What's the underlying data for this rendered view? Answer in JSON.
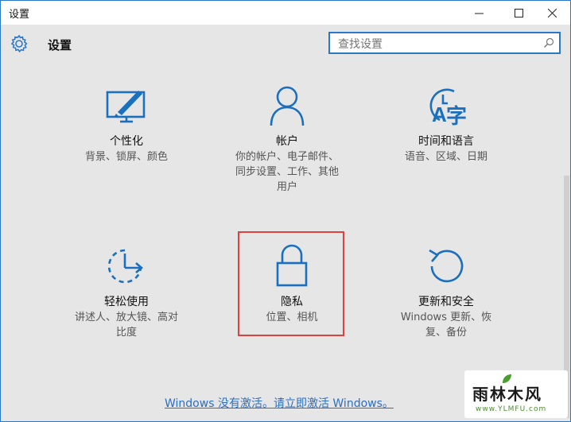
{
  "window": {
    "title": "设置"
  },
  "header": {
    "title": "设置",
    "search_placeholder": "查找设置"
  },
  "tiles": [
    {
      "label": "个性化",
      "desc": [
        "背景、锁屏、颜色"
      ]
    },
    {
      "label": "帐户",
      "desc": [
        "你的帐户、电子邮件、",
        "同步设置、工作、其他",
        "用户"
      ]
    },
    {
      "label": "时间和语言",
      "desc": [
        "语音、区域、日期"
      ]
    },
    {
      "label": "轻松使用",
      "desc": [
        "讲述人、放大镜、高对",
        "比度"
      ]
    },
    {
      "label": "隐私",
      "desc": [
        "位置、相机"
      ]
    },
    {
      "label": "更新和安全",
      "desc": [
        "Windows 更新、恢",
        "复、备份"
      ]
    }
  ],
  "activation_link": "Windows 没有激活。请立即激活 Windows。",
  "watermark": {
    "main": "雨林木风",
    "sub": "www.YLMFU.com"
  },
  "colors": {
    "accent": "#2b78c9",
    "highlight": "#e04040",
    "link": "#2b6fc1"
  }
}
